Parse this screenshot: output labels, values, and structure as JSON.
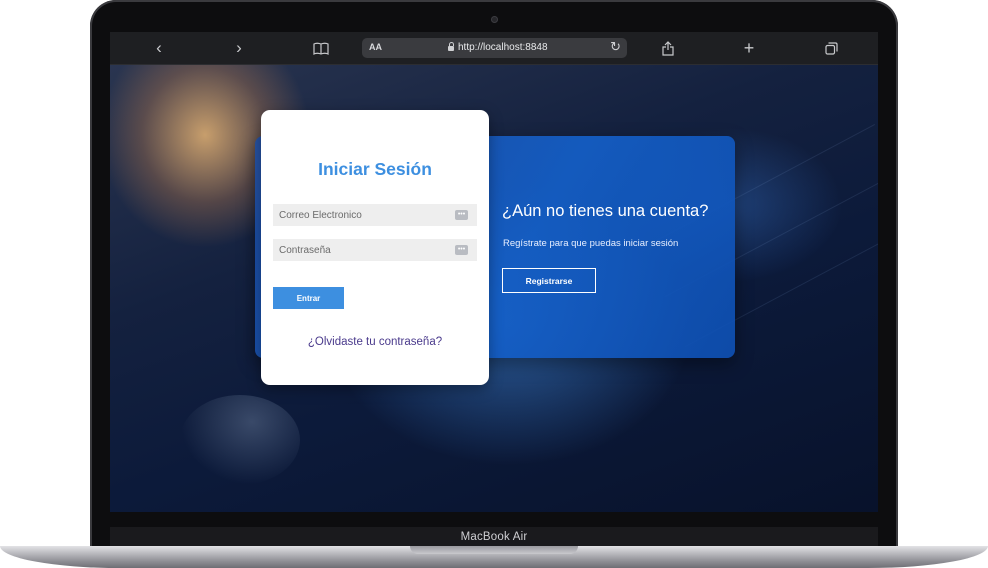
{
  "browser": {
    "text_size_label": "AA",
    "url": "http://localhost:8848",
    "icons": [
      "back-icon",
      "forward-icon",
      "bookmarks-icon",
      "lock-icon",
      "reload-icon",
      "share-icon",
      "new-tab-icon",
      "tabs-icon"
    ]
  },
  "login": {
    "title": "Iniciar Sesión",
    "email_placeholder": "Correo Electronico",
    "password_placeholder": "Contraseña",
    "submit_label": "Entrar",
    "forgot_link": "¿Olvidaste tu contraseña?"
  },
  "register": {
    "title": "¿Aún no tienes una cuenta?",
    "subtitle": "Regístrate para que puedas iniciar sesión",
    "button_label": "Registrarse"
  },
  "device": {
    "label": "MacBook Air"
  },
  "colors": {
    "accent": "#3d8fe0",
    "link": "#4a3a8c",
    "panel": "#1e5fc0"
  }
}
